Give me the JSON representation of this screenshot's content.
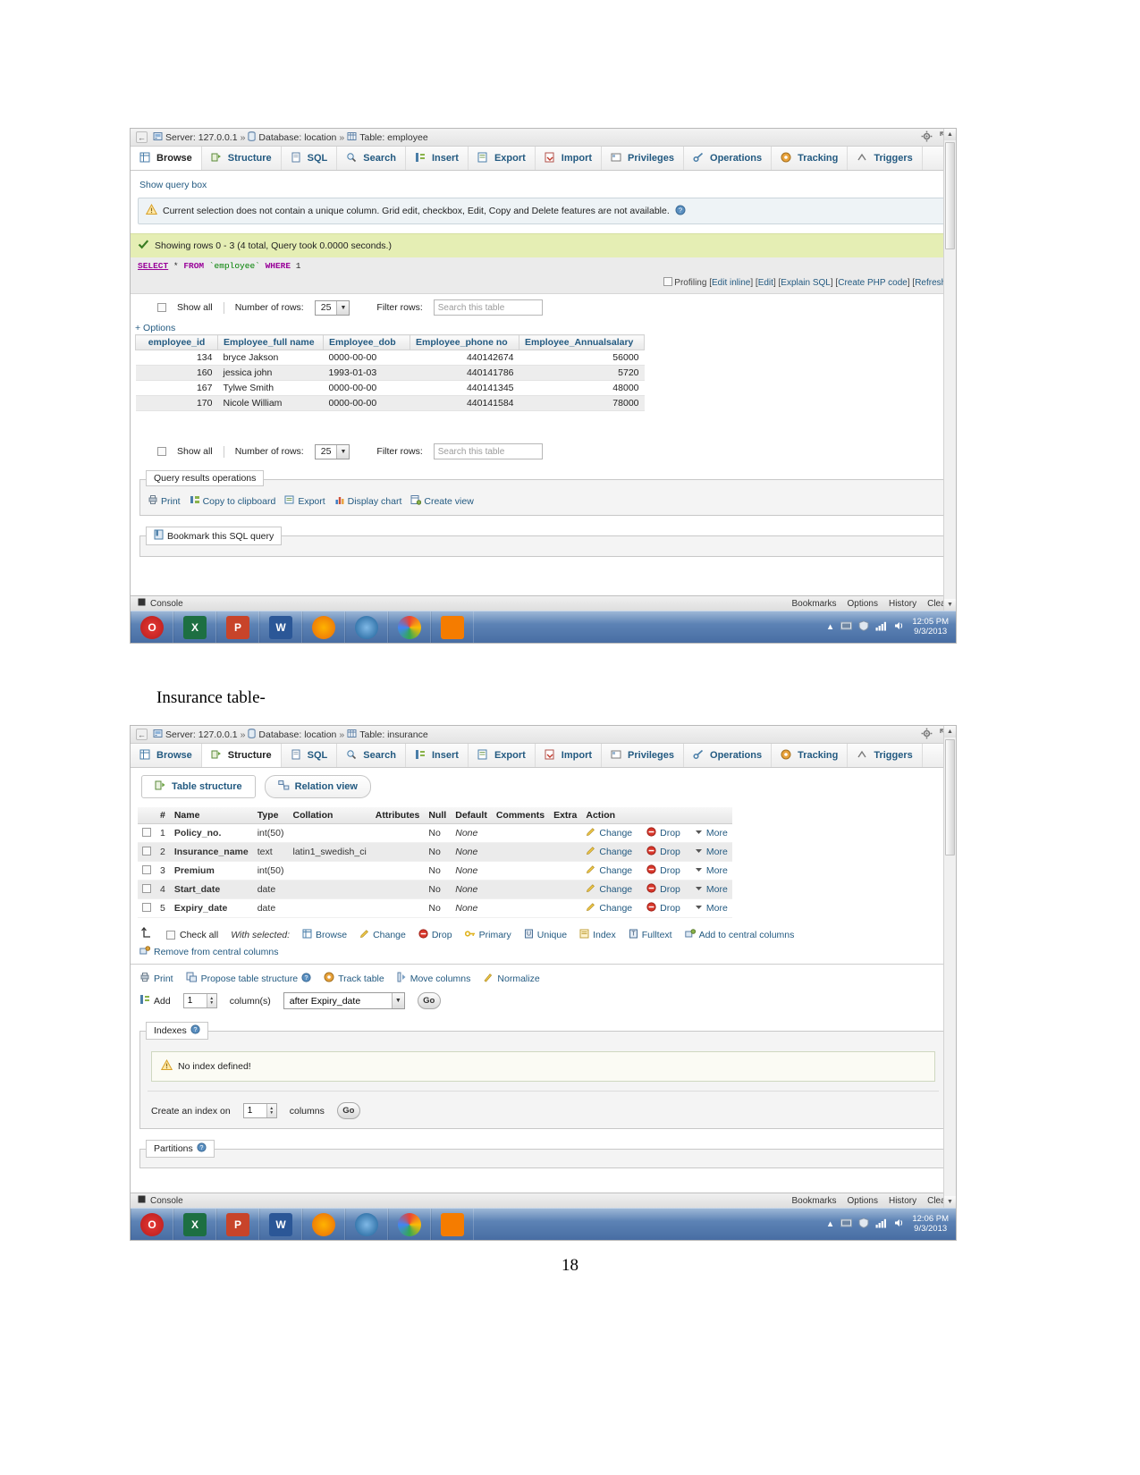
{
  "document": {
    "caption_insurance": "Insurance table-",
    "page_number": "18"
  },
  "window1": {
    "breadcrumb": {
      "back_icon": "back-arrow-icon",
      "server_label": "Server: 127.0.0.1",
      "database_label": "Database: location",
      "table_label": "Table: employee",
      "sep": "»",
      "settings_icon": "gear-icon",
      "fullscreen_icon": "expand-icon"
    },
    "tabs": [
      {
        "label": "Browse",
        "icon": "browse-icon",
        "active": true
      },
      {
        "label": "Structure",
        "icon": "structure-icon",
        "active": false
      },
      {
        "label": "SQL",
        "icon": "sql-icon",
        "active": false
      },
      {
        "label": "Search",
        "icon": "search-icon",
        "active": false
      },
      {
        "label": "Insert",
        "icon": "insert-icon",
        "active": false
      },
      {
        "label": "Export",
        "icon": "export-icon",
        "active": false
      },
      {
        "label": "Import",
        "icon": "import-icon",
        "active": false
      },
      {
        "label": "Privileges",
        "icon": "privileges-icon",
        "active": false
      },
      {
        "label": "Operations",
        "icon": "operations-icon",
        "active": false
      },
      {
        "label": "Tracking",
        "icon": "tracking-icon",
        "active": false
      },
      {
        "label": "Triggers",
        "icon": "triggers-icon",
        "active": false
      }
    ],
    "show_query_box": "Show query box",
    "notice": "Current selection does not contain a unique column. Grid edit, checkbox, Edit, Copy and Delete features are not available.",
    "success": "Showing rows 0 - 3 (4 total, Query took 0.0000 seconds.)",
    "sql": {
      "select": "SELECT",
      "star": "*",
      "from": "FROM",
      "table": "`employee`",
      "where": "WHERE",
      "one": "1"
    },
    "sql_actions": {
      "profiling": "Profiling",
      "edit_inline": "Edit inline",
      "edit": "Edit",
      "explain_sql": "Explain SQL",
      "create_php": "Create PHP code",
      "refresh": "Refresh"
    },
    "row_controls": {
      "show_all": "Show all",
      "number_of_rows_label": "Number of rows:",
      "number_of_rows_value": "25",
      "filter_rows_label": "Filter rows:",
      "filter_placeholder": "Search this table"
    },
    "options_link": "+ Options",
    "results": {
      "columns": [
        "employee_id",
        "Employee_full name",
        "Employee_dob",
        "Employee_phone no",
        "Employee_Annualsalary"
      ],
      "rows": [
        [
          "134",
          "bryce Jakson",
          "0000-00-00",
          "440142674",
          "56000"
        ],
        [
          "160",
          "jessica john",
          "1993-01-03",
          "440141786",
          "5720"
        ],
        [
          "167",
          "Tylwe Smith",
          "0000-00-00",
          "440141345",
          "48000"
        ],
        [
          "170",
          "Nicole William",
          "0000-00-00",
          "440141584",
          "78000"
        ]
      ]
    },
    "query_results_operations": {
      "legend": "Query results operations",
      "items": [
        {
          "label": "Print",
          "icon": "print-icon"
        },
        {
          "label": "Copy to clipboard",
          "icon": "clipboard-icon"
        },
        {
          "label": "Export",
          "icon": "export-icon"
        },
        {
          "label": "Display chart",
          "icon": "chart-icon"
        },
        {
          "label": "Create view",
          "icon": "view-icon"
        }
      ]
    },
    "bookmark": {
      "legend": "Bookmark this SQL query",
      "icon": "bookmark-icon"
    },
    "console": {
      "label": "Console",
      "bookmarks": "Bookmarks",
      "options": "Options",
      "history": "History",
      "clear": "Clear"
    },
    "taskbar": {
      "apps": [
        {
          "name": "opera-icon",
          "label": "O",
          "color": "#d32f2f"
        },
        {
          "name": "excel-icon",
          "label": "X",
          "color": "#1d6f42"
        },
        {
          "name": "powerpoint-icon",
          "label": "P",
          "color": "#c8442a"
        },
        {
          "name": "word-icon",
          "label": "W",
          "color": "#2b5797"
        },
        {
          "name": "firefox-icon",
          "label": "",
          "color": "#e8690b"
        },
        {
          "name": "safari-icon",
          "label": "",
          "color": "#2b7fc2"
        },
        {
          "name": "chrome-icon",
          "label": "",
          "color": "#4caf50"
        },
        {
          "name": "xampp-icon",
          "label": "",
          "color": "#f57c00"
        }
      ],
      "time": "12:05 PM",
      "date": "9/3/2013"
    }
  },
  "window2": {
    "breadcrumb": {
      "back_icon": "back-arrow-icon",
      "server_label": "Server: 127.0.0.1",
      "database_label": "Database: location",
      "table_label": "Table: insurance",
      "sep": "»",
      "settings_icon": "gear-icon",
      "fullscreen_icon": "expand-icon"
    },
    "tabs": [
      {
        "label": "Browse",
        "icon": "browse-icon",
        "active": false
      },
      {
        "label": "Structure",
        "icon": "structure-icon",
        "active": true
      },
      {
        "label": "SQL",
        "icon": "sql-icon",
        "active": false
      },
      {
        "label": "Search",
        "icon": "search-icon",
        "active": false
      },
      {
        "label": "Insert",
        "icon": "insert-icon",
        "active": false
      },
      {
        "label": "Export",
        "icon": "export-icon",
        "active": false
      },
      {
        "label": "Import",
        "icon": "import-icon",
        "active": false
      },
      {
        "label": "Privileges",
        "icon": "privileges-icon",
        "active": false
      },
      {
        "label": "Operations",
        "icon": "operations-icon",
        "active": false
      },
      {
        "label": "Tracking",
        "icon": "tracking-icon",
        "active": false
      },
      {
        "label": "Triggers",
        "icon": "triggers-icon",
        "active": false
      }
    ],
    "subtabs": [
      {
        "label": "Table structure",
        "icon": "table-structure-icon",
        "active": true
      },
      {
        "label": "Relation view",
        "icon": "relation-view-icon",
        "active": false
      }
    ],
    "structure": {
      "columns": [
        "#",
        "Name",
        "Type",
        "Collation",
        "Attributes",
        "Null",
        "Default",
        "Comments",
        "Extra",
        "Action"
      ],
      "rows": [
        {
          "num": "1",
          "name": "Policy_no.",
          "type": "int(50)",
          "collation": "",
          "attributes": "",
          "null": "No",
          "default": "None",
          "comments": "",
          "extra": ""
        },
        {
          "num": "2",
          "name": "Insurance_name",
          "type": "text",
          "collation": "latin1_swedish_ci",
          "attributes": "",
          "null": "No",
          "default": "None",
          "comments": "",
          "extra": ""
        },
        {
          "num": "3",
          "name": "Premium",
          "type": "int(50)",
          "collation": "",
          "attributes": "",
          "null": "No",
          "default": "None",
          "comments": "",
          "extra": ""
        },
        {
          "num": "4",
          "name": "Start_date",
          "type": "date",
          "collation": "",
          "attributes": "",
          "null": "No",
          "default": "None",
          "comments": "",
          "extra": ""
        },
        {
          "num": "5",
          "name": "Expiry_date",
          "type": "date",
          "collation": "",
          "attributes": "",
          "null": "No",
          "default": "None",
          "comments": "",
          "extra": ""
        }
      ],
      "action_labels": {
        "change": "Change",
        "drop": "Drop",
        "more": "More"
      }
    },
    "with_selected": {
      "check_all": "Check all",
      "label": "With selected:",
      "items": [
        {
          "label": "Browse",
          "icon": "browse-icon"
        },
        {
          "label": "Change",
          "icon": "pencil-icon"
        },
        {
          "label": "Drop",
          "icon": "drop-icon"
        },
        {
          "label": "Primary",
          "icon": "key-icon"
        },
        {
          "label": "Unique",
          "icon": "unique-icon"
        },
        {
          "label": "Index",
          "icon": "index-icon"
        },
        {
          "label": "Fulltext",
          "icon": "fulltext-icon"
        },
        {
          "label": "Add to central columns",
          "icon": "add-central-icon"
        }
      ],
      "remove_central": "Remove from central columns"
    },
    "bottom_tools": [
      {
        "label": "Print",
        "icon": "print-icon"
      },
      {
        "label": "Propose table structure",
        "icon": "propose-icon"
      },
      {
        "label": "Track table",
        "icon": "tracking-icon"
      },
      {
        "label": "Move columns",
        "icon": "move-columns-icon"
      },
      {
        "label": "Normalize",
        "icon": "normalize-icon"
      }
    ],
    "add_columns": {
      "add_label": "Add",
      "count": "1",
      "columns_label": "column(s)",
      "position": "after Expiry_date",
      "go": "Go"
    },
    "indexes": {
      "legend": "Indexes",
      "no_index": "No index defined!",
      "create_label": "Create an index on",
      "create_count": "1",
      "columns_label": "columns",
      "go": "Go"
    },
    "partitions": {
      "legend": "Partitions"
    },
    "console": {
      "label": "Console",
      "bookmarks": "Bookmarks",
      "options": "Options",
      "history": "History",
      "clear": "Clear"
    },
    "taskbar": {
      "apps": [
        {
          "name": "opera-icon",
          "label": "O",
          "color": "#d32f2f"
        },
        {
          "name": "excel-icon",
          "label": "X",
          "color": "#1d6f42"
        },
        {
          "name": "powerpoint-icon",
          "label": "P",
          "color": "#c8442a"
        },
        {
          "name": "word-icon",
          "label": "W",
          "color": "#2b5797"
        },
        {
          "name": "firefox-icon",
          "label": "",
          "color": "#e8690b"
        },
        {
          "name": "safari-icon",
          "label": "",
          "color": "#2b7fc2"
        },
        {
          "name": "chrome-icon",
          "label": "",
          "color": "#4caf50"
        },
        {
          "name": "xampp-icon",
          "label": "",
          "color": "#f57c00"
        }
      ],
      "time": "12:06 PM",
      "date": "9/3/2013"
    }
  }
}
